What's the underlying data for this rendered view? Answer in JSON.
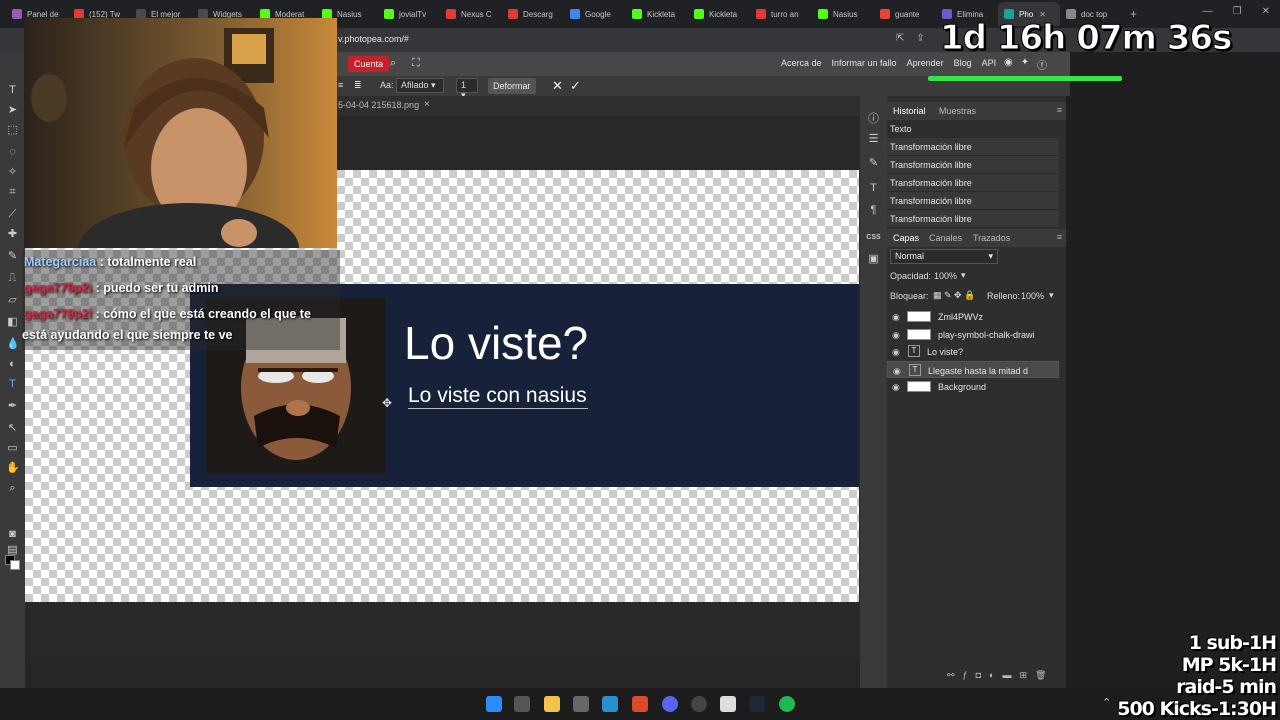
{
  "browser": {
    "tabs": [
      {
        "label": "Panel de",
        "color": "#9b59b6"
      },
      {
        "label": "(152) Tw",
        "color": "#e53935"
      },
      {
        "label": "El mejor",
        "color": "#4a4a4a"
      },
      {
        "label": "Widgets",
        "color": "#4a4a4a"
      },
      {
        "label": "Moderat",
        "color": "#53fc18"
      },
      {
        "label": "Nasius",
        "color": "#53fc18"
      },
      {
        "label": "jovialTv",
        "color": "#53fc18"
      },
      {
        "label": "Nexus C",
        "color": "#e53935"
      },
      {
        "label": "Descarg",
        "color": "#e53935"
      },
      {
        "label": "Google",
        "color": "#4285f4"
      },
      {
        "label": "Kickleta",
        "color": "#53fc18"
      },
      {
        "label": "Kickleta",
        "color": "#53fc18"
      },
      {
        "label": "turro an",
        "color": "#e53935"
      },
      {
        "label": "Nasius",
        "color": "#53fc18"
      },
      {
        "label": "guante",
        "color": "#ea4335"
      },
      {
        "label": "Elimina",
        "color": "#6a5acd"
      },
      {
        "label": "Pho",
        "color": "#18a497",
        "active": true
      },
      {
        "label": "doc top",
        "color": "#888888"
      }
    ],
    "new_tab": "+",
    "window_controls": [
      "—",
      "❐",
      "✕"
    ],
    "url": "v.photopea.com/#"
  },
  "photopea": {
    "cuenta_label": "Cuenta",
    "menu_links": [
      "Acerca de",
      "Informar un fallo",
      "Aprender",
      "Blog",
      "API"
    ],
    "social_icons": [
      "reddit-icon",
      "twitter-icon",
      "facebook-icon"
    ],
    "options": {
      "aa_label": "Aa:",
      "aa_value": "Afilado",
      "one_value": "1",
      "deformar_label": "Deformar",
      "cancel_mark": "✕",
      "commit_mark": "✓"
    },
    "doc_tab": "5-04-04 215618.png",
    "doc_tab_close": "×",
    "canvas": {
      "title": "Lo viste?",
      "subtitle": "Lo viste con nasius"
    },
    "history": {
      "tab_active": "Historial",
      "tab_other": "Muestras",
      "items": [
        "Texto",
        "Transformación libre",
        "Transformación libre",
        "Transformación libre",
        "Transformación libre",
        "Transformación libre"
      ]
    },
    "layers": {
      "tabs": [
        "Capas",
        "Canales",
        "Trazados"
      ],
      "blend_mode": "Normal",
      "opacity_label": "Opacidad:",
      "opacity_value": "100%",
      "lock_label": "Bloquear:",
      "fill_label": "Relleno:",
      "fill_value": "100%",
      "items": [
        {
          "name": "Zml4PWVz",
          "kind": "image"
        },
        {
          "name": "play-symbol-chalk-drawi",
          "kind": "image"
        },
        {
          "name": "Lo viste?",
          "kind": "text"
        },
        {
          "name": "Llegaste hasta la mitad d",
          "kind": "text",
          "selected": true
        },
        {
          "name": "Background",
          "kind": "image"
        }
      ]
    }
  },
  "stream": {
    "chat": [
      {
        "user": "Mategarciaa",
        "msg": " : totalmente real"
      },
      {
        "user": "gaga779p2i",
        "msg": " : puedo ser tu admin"
      },
      {
        "user": "gaga779p2i",
        "msg": " : cómo el que está creando el que te"
      },
      {
        "user": "",
        "msg": "está ayudando el que siempre te ve"
      }
    ],
    "timer": "1d 16h 07m 36s",
    "goals": [
      "1 sub-1H",
      "MP 5k-1H",
      "raid-5 min",
      "500 Kicks-1:30H"
    ]
  },
  "colors": {
    "accent_red": "#c8202b",
    "timer_bar": "#34e64a",
    "banner_bg": "#17223a"
  }
}
